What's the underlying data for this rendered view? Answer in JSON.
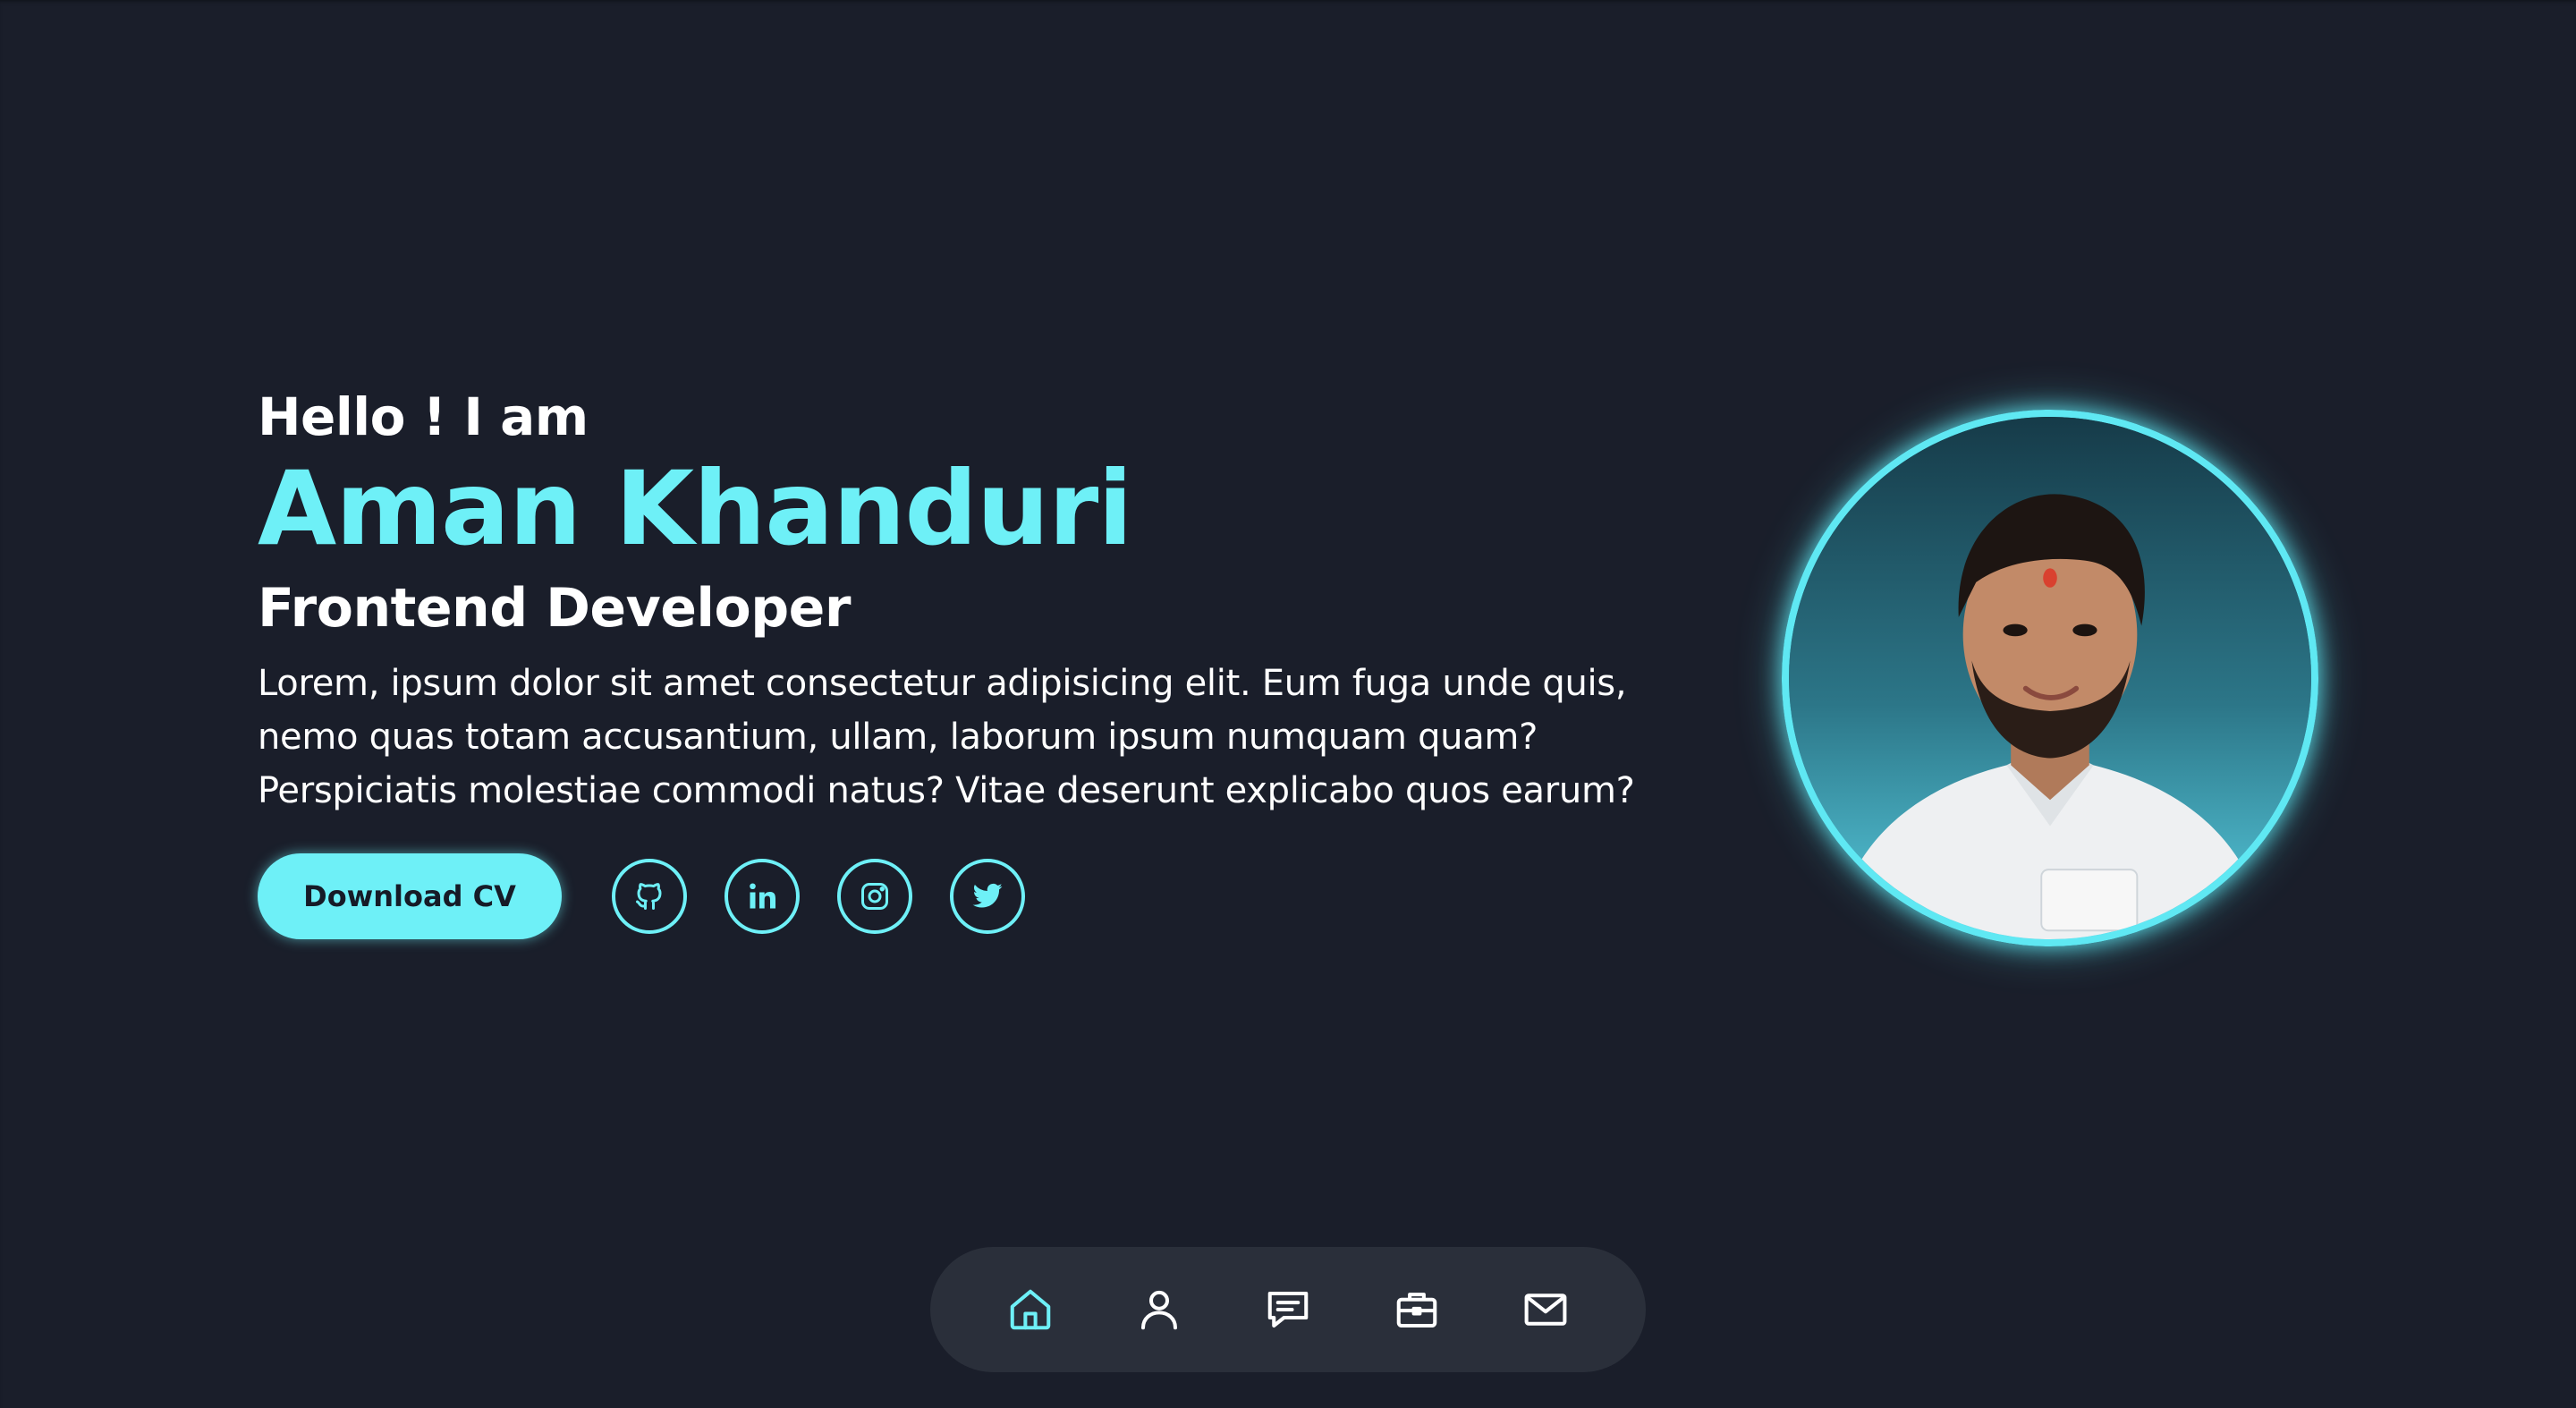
{
  "hero": {
    "greeting": "Hello ! I am",
    "name": "Aman Khanduri",
    "role": "Frontend Developer",
    "description": "Lorem, ipsum dolor sit amet consectetur adipisicing elit. Eum fuga unde quis, nemo quas totam accusantium, ullam, laborum ipsum numquam quam? Perspiciatis molestiae commodi natus? Vitae deserunt explicabo quos earum?",
    "cv_button_label": "Download CV"
  },
  "socials": [
    {
      "icon": "github-icon"
    },
    {
      "icon": "linkedin-icon"
    },
    {
      "icon": "instagram-icon"
    },
    {
      "icon": "twitter-icon"
    }
  ],
  "dock": [
    {
      "icon": "home-icon",
      "active": true
    },
    {
      "icon": "user-icon",
      "active": false
    },
    {
      "icon": "message-icon",
      "active": false
    },
    {
      "icon": "briefcase-icon",
      "active": false
    },
    {
      "icon": "mail-icon",
      "active": false
    }
  ],
  "colors": {
    "background": "#1a1e2a",
    "accent": "#6ef0f7",
    "dock_background": "#2a2f3a",
    "text": "#ffffff"
  }
}
